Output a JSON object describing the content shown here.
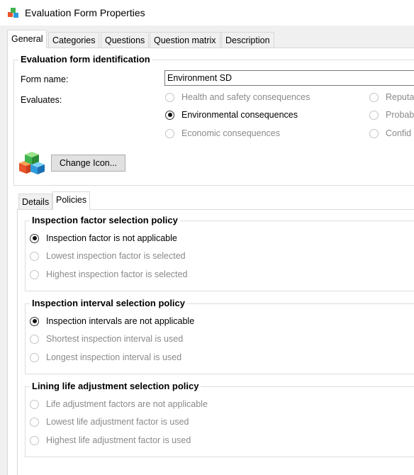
{
  "window": {
    "title": "Evaluation Form Properties",
    "icon": "cubes-icon"
  },
  "tabs": [
    {
      "label": "General",
      "active": true
    },
    {
      "label": "Categories"
    },
    {
      "label": "Questions"
    },
    {
      "label": "Question matrix"
    },
    {
      "label": "Description"
    }
  ],
  "identification": {
    "legend": "Evaluation form identification",
    "form_name_label": "Form name:",
    "form_name_value": "Environment SD",
    "evaluates_label": "Evaluates:",
    "options": [
      {
        "label": "Health and safety consequences",
        "checked": false,
        "enabled": false
      },
      {
        "label": "Environmental consequences",
        "checked": true,
        "enabled": true
      },
      {
        "label": "Economic consequences",
        "checked": false,
        "enabled": false
      },
      {
        "label": "Reputa",
        "checked": false,
        "enabled": false
      },
      {
        "label": "Probab",
        "checked": false,
        "enabled": false
      },
      {
        "label": "Confid",
        "checked": false,
        "enabled": false
      }
    ],
    "change_icon_label": "Change Icon..."
  },
  "subtabs": [
    {
      "label": "Details"
    },
    {
      "label": "Policies",
      "active": true
    }
  ],
  "policies": {
    "inspection_factor": {
      "legend": "Inspection factor selection policy",
      "options": [
        {
          "label": "Inspection factor is not applicable",
          "checked": true,
          "enabled": true
        },
        {
          "label": "Lowest inspection factor is selected",
          "checked": false,
          "enabled": false
        },
        {
          "label": "Highest inspection factor is selected",
          "checked": false,
          "enabled": false
        }
      ]
    },
    "inspection_interval": {
      "legend": "Inspection interval selection policy",
      "options": [
        {
          "label": "Inspection intervals are not applicable",
          "checked": true,
          "enabled": true
        },
        {
          "label": "Shortest inspection interval is used",
          "checked": false,
          "enabled": false
        },
        {
          "label": "Longest inspection interval is used",
          "checked": false,
          "enabled": false
        }
      ]
    },
    "lining_life": {
      "legend": "Lining life adjustment selection policy",
      "options": [
        {
          "label": "Life adjustment factors are not applicable",
          "checked": false,
          "enabled": false
        },
        {
          "label": "Lowest life adjustment factor is used",
          "checked": false,
          "enabled": false
        },
        {
          "label": "Highest life adjustment factor is used",
          "checked": false,
          "enabled": false
        }
      ]
    }
  }
}
